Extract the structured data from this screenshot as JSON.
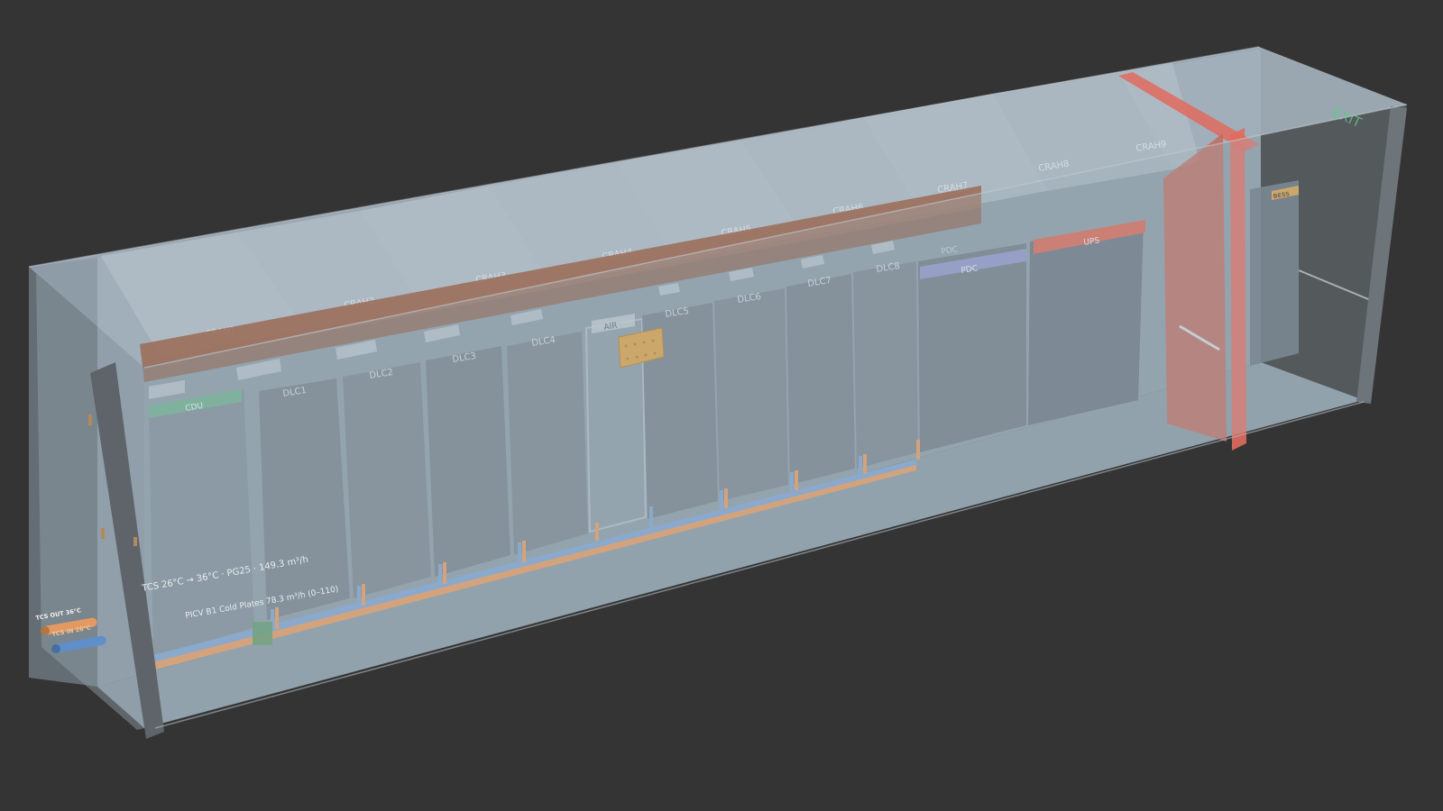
{
  "colors": {
    "background": "#343434",
    "container_shell": "#9aa9b4",
    "hot_supply": "#e39a62",
    "cold_supply": "#7fa3cf",
    "cdu": "#6fae8f",
    "pdc": "#8f96c8",
    "ups": "#d96a58",
    "fire_wall": "#e16a5e",
    "valve": "#d9a04a",
    "exit_sign": "#4fd27b"
  },
  "crah_units": [
    "CRAH1",
    "CRAH2",
    "CRAH3",
    "CRAH4",
    "CRAH5",
    "CRAH6",
    "CRAH7",
    "CRAH8",
    "CRAH9"
  ],
  "racks": [
    "DLC1",
    "DLC2",
    "DLC3",
    "DLC4",
    "DLC5",
    "DLC6",
    "DLC7",
    "DLC8"
  ],
  "equipment": {
    "cdu": "CDU",
    "air_unit": "AIR",
    "pdc": "PDC",
    "ups": "UPS",
    "unit_tag": "PDC",
    "battery": "BESS"
  },
  "exit_sign": "EXIT",
  "annotations": {
    "tcs_line": "TCS 26°C → 36°C · PG25 · 149.3 m³/h",
    "picv_line": "PICV B1 Cold Plates 78.3 m³/h (0–110)"
  },
  "pipes": {
    "out_label": "TCS OUT 36°C",
    "in_label": "TCS IN 26°C"
  }
}
